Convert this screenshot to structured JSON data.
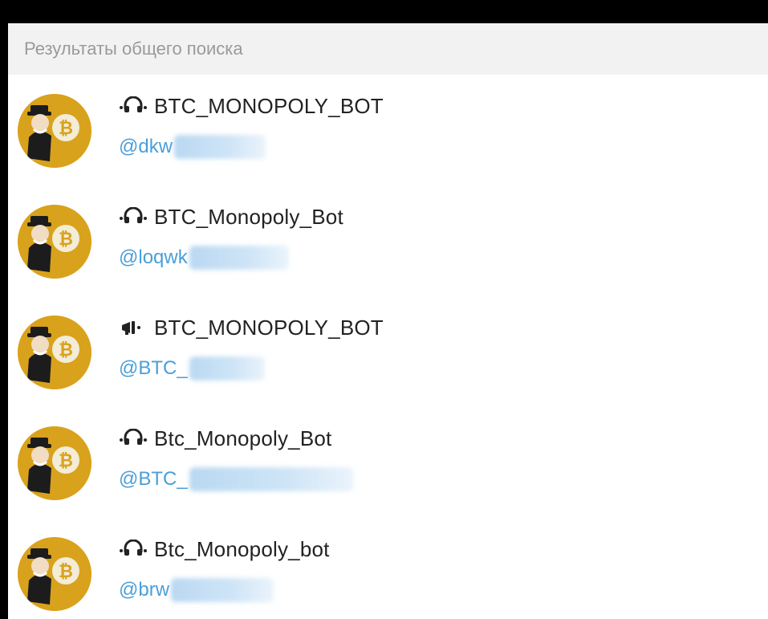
{
  "header": {
    "title": "Результаты общего поиска"
  },
  "results": [
    {
      "icon": "headphones-icon",
      "name": "BTC_MONOPOLY_BOT",
      "username": "@dkw"
    },
    {
      "icon": "headphones-icon",
      "name": "BTC_Monopoly_Bot",
      "username": "@loqwk"
    },
    {
      "icon": "megaphone-icon",
      "name": "BTC_MONOPOLY_BOT",
      "username": "@BTC_"
    },
    {
      "icon": "headphones-icon",
      "name": "Btc_Monopoly_Bot",
      "username": "@BTC_"
    },
    {
      "icon": "headphones-icon",
      "name": "Btc_Monopoly_bot",
      "username": "@brw"
    }
  ],
  "colors": {
    "background": "#000000",
    "panel": "#ffffff",
    "header_bg": "#f2f2f2",
    "header_text": "#9a9a9a",
    "name_text": "#222222",
    "username_text": "#4a9fd8",
    "avatar_bg": "#d9a21c"
  }
}
